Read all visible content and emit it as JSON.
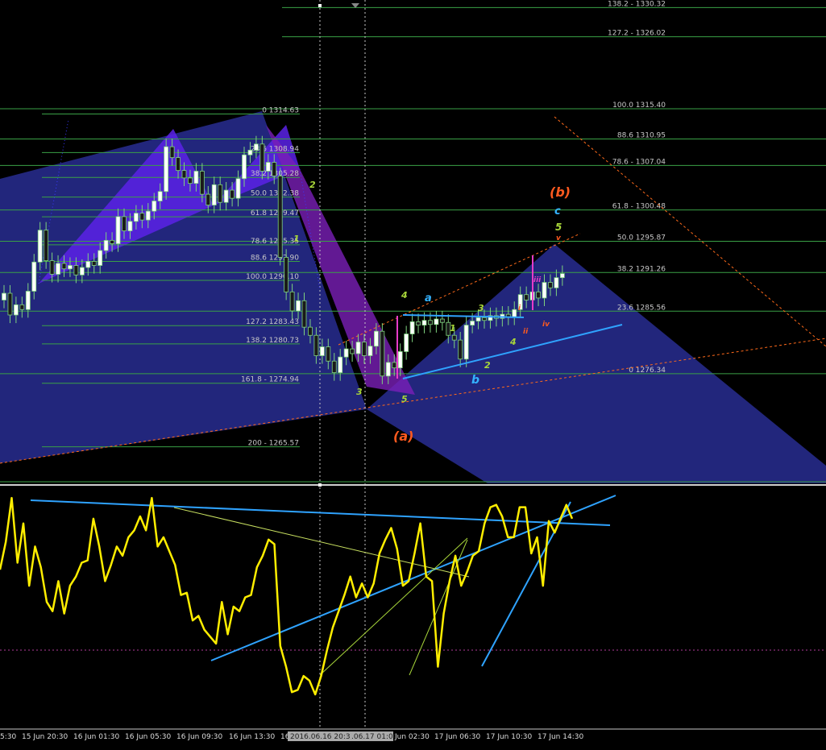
{
  "colors": {
    "background": "#000000",
    "fib_line": "#3aa046",
    "pattern_purple": "#6a1fd6",
    "pattern_navy": "#262a8a",
    "bull_candle": "#ffffff",
    "bear_candle": "#1a1a1a",
    "candle_wick": "#7fd37f",
    "trend_blue": "#2fa3ff",
    "oscillator": "#ffee00",
    "wave_orange": "#ff5a1f",
    "wave_green": "#a8d63a",
    "wave_cyan": "#34b2ff",
    "wave_magenta": "#e63cc8",
    "dashed_orange": "#ff6a1a"
  },
  "price_panel": {
    "fib_left": [
      {
        "text": "0 1314.63"
      },
      {
        "text": "23.6 1308.94"
      },
      {
        "text": "38.2 1305.28"
      },
      {
        "text": "50.0 1302.38"
      },
      {
        "text": "61.8 1299.47"
      },
      {
        "text": "78.6 1295.35"
      },
      {
        "text": "88.6 1292.90"
      },
      {
        "text": "100.0 1290.10"
      },
      {
        "text": "127.2 1283.43"
      },
      {
        "text": "138.2 1280.73"
      },
      {
        "text": "161.8 - 1274.94"
      },
      {
        "text": "200 - 1265.57"
      }
    ],
    "fib_right": [
      {
        "text": "138.2 - 1330.32"
      },
      {
        "text": "127.2 - 1326.02"
      },
      {
        "text": "100.0 1315.40"
      },
      {
        "text": "88.6 1310.95"
      },
      {
        "text": "78.6 - 1307.04"
      },
      {
        "text": "61.8 - 1300.48"
      },
      {
        "text": "50.0 1295.87"
      },
      {
        "text": "38.2 1291.26"
      },
      {
        "text": "23.6 1285.56"
      },
      {
        "text": "0 1276.34"
      }
    ],
    "wave_labels": [
      {
        "text": "(b)",
        "color": "#ff5a1f"
      },
      {
        "text": "(a)",
        "color": "#ff5a1f"
      },
      {
        "text": "c",
        "color": "#34b2ff"
      },
      {
        "text": "5",
        "color": "#a8d63a"
      },
      {
        "text": "v",
        "color": "#ff5a1f"
      },
      {
        "text": "a",
        "color": "#34b2ff"
      },
      {
        "text": "b",
        "color": "#34b2ff"
      },
      {
        "text": "4",
        "color": "#a8d63a"
      },
      {
        "text": "3",
        "color": "#a8d63a"
      },
      {
        "text": "2",
        "color": "#a8d63a"
      },
      {
        "text": "4",
        "color": "#a8d63a"
      },
      {
        "text": "5",
        "color": "#a8d63a"
      },
      {
        "text": "3",
        "color": "#a8d63a"
      },
      {
        "text": "2",
        "color": "#a8d63a"
      },
      {
        "text": "1",
        "color": "#a8d63a"
      },
      {
        "text": "1",
        "color": "#a8d63a"
      },
      {
        "text": "iii",
        "color": "#e63cc8"
      },
      {
        "text": "i",
        "color": "#ff5a1f"
      },
      {
        "text": "ii",
        "color": "#ff5a1f"
      },
      {
        "text": "iv",
        "color": "#ff5a1f"
      }
    ]
  },
  "time_axis": {
    "labels": [
      "5:30",
      "15 Jun 20:30",
      "16 Jun 01:30",
      "16 Jun 05:30",
      "16 Jun 09:30",
      "16 Jun 13:30",
      "16",
      "Jun 02:30",
      "17 Jun 06:30",
      "17 Jun 10:30",
      "17 Jun 14:30"
    ],
    "crosshair_label_1": "2016.06.16 20:30",
    "crosshair_label_2": ".06.17 01:00"
  },
  "chart_data": [
    {
      "type": "candlestick",
      "title": "",
      "ylim": [
        1262,
        1333
      ],
      "fib_levels_left": [
        1314.63,
        1308.94,
        1305.28,
        1302.38,
        1299.47,
        1295.35,
        1292.9,
        1290.1,
        1283.43,
        1280.73,
        1274.94,
        1265.57
      ],
      "fib_levels_right": [
        1330.32,
        1326.02,
        1315.4,
        1310.95,
        1307.04,
        1300.48,
        1295.87,
        1291.26,
        1285.56,
        1276.34
      ],
      "grid": false,
      "legend": "none",
      "close_series": [
        1288.2,
        1285.0,
        1286.5,
        1285.8,
        1288.5,
        1292.8,
        1297.5,
        1293.0,
        1291.0,
        1292.6,
        1291.8,
        1292.3,
        1290.9,
        1292.0,
        1292.9,
        1292.3,
        1294.5,
        1296.0,
        1295.5,
        1299.5,
        1297.4,
        1298.8,
        1300.0,
        1299.0,
        1300.3,
        1301.8,
        1303.2,
        1309.8,
        1308.2,
        1306.3,
        1305.2,
        1304.4,
        1306.2,
        1302.8,
        1301.2,
        1304.2,
        1301.6,
        1303.4,
        1302.2,
        1305.1,
        1308.6,
        1309.3,
        1310.2,
        1306.2,
        1307.5,
        1305.5,
        1293.5,
        1288.4,
        1285.6,
        1287.1,
        1283.2,
        1282.0,
        1279.0,
        1280.3,
        1278.2,
        1276.5,
        1278.8,
        1280.0,
        1279.3,
        1281.0,
        1279.0,
        1280.4,
        1282.6,
        1276.0,
        1278.0,
        1277.2,
        1279.6,
        1282.2,
        1284.0,
        1283.5,
        1284.2,
        1283.6,
        1284.4,
        1283.9,
        1282.0,
        1281.3,
        1278.5,
        1283.5,
        1284.1,
        1284.6,
        1284.2,
        1284.9,
        1284.5,
        1285.1,
        1284.7,
        1285.8,
        1288.0,
        1287.2,
        1288.4,
        1287.5,
        1289.8,
        1289.0,
        1290.5,
        1291.1
      ],
      "highs_lows": {
        "swing_high": 1314.63,
        "swing_low": 1276.34
      }
    },
    {
      "type": "line",
      "title": "",
      "series": [
        {
          "values": [
            62,
            74,
            93,
            65,
            82,
            55,
            72,
            63,
            48,
            44,
            57,
            43,
            55,
            59,
            65,
            66,
            84,
            72,
            57,
            64,
            72,
            68,
            76,
            79,
            85,
            79,
            93,
            72,
            76,
            70,
            64,
            51,
            52,
            40,
            42,
            36,
            33,
            30,
            48,
            34,
            46,
            44,
            50,
            51,
            63,
            68,
            75,
            73,
            29,
            20,
            9,
            10,
            16,
            14,
            8,
            16,
            27,
            37,
            44,
            51,
            59,
            50,
            56,
            50,
            56,
            69,
            75,
            80,
            71,
            55,
            57,
            69,
            82,
            59,
            57,
            20,
            43,
            57,
            68,
            55,
            61,
            68,
            70,
            82,
            89,
            90,
            85,
            76,
            76,
            89,
            89,
            69,
            76,
            55,
            83,
            78,
            84,
            90,
            84
          ]
        }
      ],
      "ylim": [
        0,
        100
      ],
      "grid": false,
      "legend": "none"
    }
  ]
}
